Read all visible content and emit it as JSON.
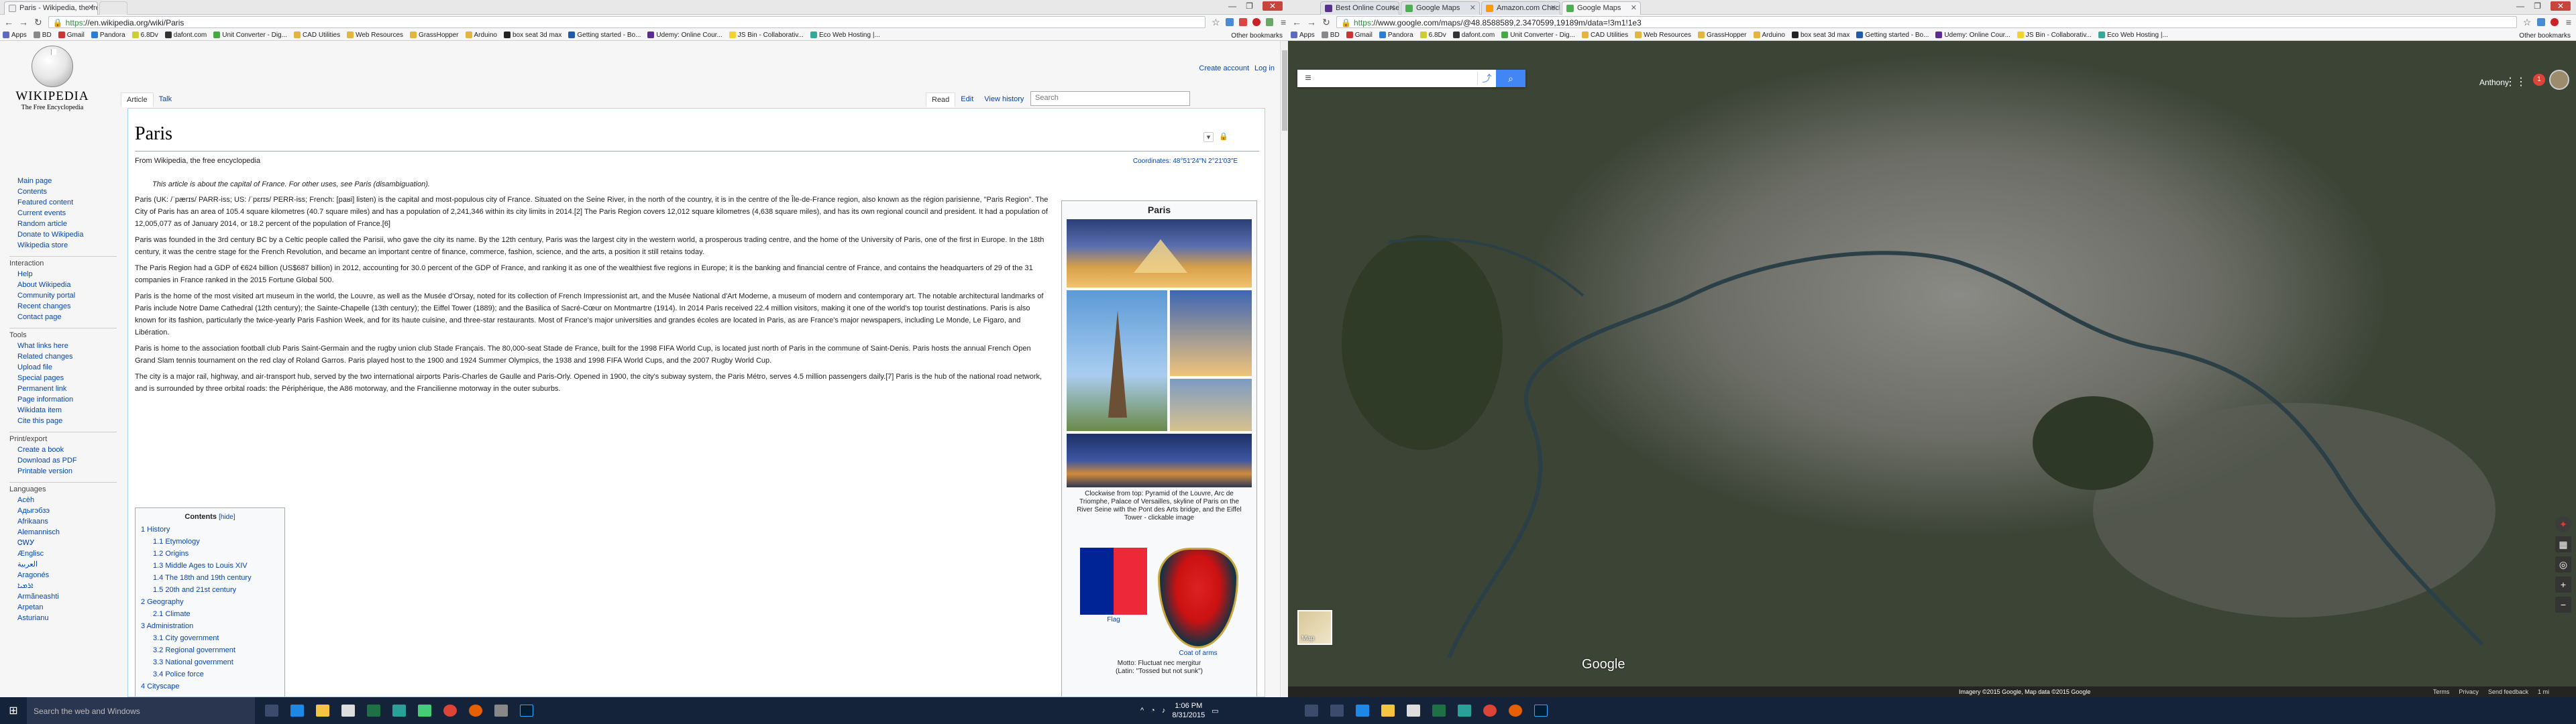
{
  "left_window": {
    "tabs": [
      {
        "title": "Paris - Wikipedia, the free",
        "active": true
      },
      {
        "title": "",
        "active": false
      }
    ],
    "url_https": "https",
    "url_rest": "://en.wikipedia.org/wiki/Paris"
  },
  "right_window": {
    "tabs": [
      {
        "title": "Best Online Courses | Ud...",
        "active": false
      },
      {
        "title": "Google Maps",
        "active": false
      },
      {
        "title": "Amazon.com Checkout",
        "active": false
      },
      {
        "title": "Google Maps",
        "active": true
      }
    ],
    "url_https": "https",
    "url_rest": "://www.google.com/maps/@48.8588589,2.3470599,19189m/data=!3m1!1e3"
  },
  "bookmarks": [
    "Apps",
    "BD",
    "Gmail",
    "Pandora",
    "6.8Dv",
    "dafont.com",
    "Unit Converter - Dig...",
    "CAD Utilities",
    "Web Resources",
    "GrassHopper",
    "Arduino",
    "box seat 3d max",
    "Getting started - Bo...",
    "Udemy: Online Cour...",
    "JS Bin - Collaborativ...",
    "Eco Web Hosting |..."
  ],
  "bookmarks_right": [
    "Apps",
    "BD",
    "Gmail",
    "Pandora",
    "6.8Dv",
    "dafont.com",
    "Unit Converter - Dig...",
    "CAD Utilities",
    "Web Resources",
    "GrassHopper",
    "Arduino",
    "box seat 3d max",
    "Getting started - Bo...",
    "Udemy: Online Cour...",
    "JS Bin - Collaborativ...",
    "Eco Web Hosting |..."
  ],
  "other_bookmarks": "Other bookmarks",
  "wiki": {
    "logo_title": "WIKIPEDIA",
    "logo_sub": "The Free Encyclopedia",
    "create_account": "Create account",
    "log_in": "Log in",
    "tab_article": "Article",
    "tab_talk": "Talk",
    "tab_read": "Read",
    "tab_edit": "Edit",
    "tab_history": "View history",
    "search_placeholder": "Search",
    "nav": [
      "Main page",
      "Contents",
      "Featured content",
      "Current events",
      "Random article",
      "Donate to Wikipedia",
      "Wikipedia store"
    ],
    "interaction_head": "Interaction",
    "interaction": [
      "Help",
      "About Wikipedia",
      "Community portal",
      "Recent changes",
      "Contact page"
    ],
    "tools_head": "Tools",
    "tools": [
      "What links here",
      "Related changes",
      "Upload file",
      "Special pages",
      "Permanent link",
      "Page information",
      "Wikidata item",
      "Cite this page"
    ],
    "print_head": "Print/export",
    "print": [
      "Create a book",
      "Download as PDF",
      "Printable version"
    ],
    "lang_head": "Languages",
    "langs": [
      "Acèh",
      "Адыгэбзэ",
      "Afrikaans",
      "Alemannisch",
      "ᏣᎳᎩ",
      "Ænglisc",
      "العربية",
      "Aragonés",
      "ܐܪܡܝܐ",
      "Armãneashti",
      "Arpetan",
      "Asturianu"
    ],
    "title": "Paris",
    "from": "From Wikipedia, the free encyclopedia",
    "coordinates": "Coordinates: 48°51′24″N 2°21′03″E",
    "hatnote": "This article is about the capital of France. For other uses, see Paris (disambiguation).",
    "paragraphs": [
      "Paris (UK: /ˈpærɪs/ PARR-iss; US: /ˈpɛrɪs/ PERR-iss; French: [paʁi] listen) is the capital and most-populous city of France. Situated on the Seine River, in the north of the country, it is in the centre of the Île-de-France region, also known as the région parisienne, \"Paris Region\". The City of Paris has an area of 105.4 square kilometres (40.7 square miles) and has a population of 2,241,346 within its city limits in 2014.[2] The Paris Region covers 12,012 square kilometres (4,638 square miles), and has its own regional council and president. It had a population of 12,005,077 as of January 2014, or 18.2 percent of the population of France.[6]",
      "Paris was founded in the 3rd century BC by a Celtic people called the Parisii, who gave the city its name. By the 12th century, Paris was the largest city in the western world, a prosperous trading centre, and the home of the University of Paris, one of the first in Europe. In the 18th century, it was the centre stage for the French Revolution, and became an important centre of finance, commerce, fashion, science, and the arts, a position it still retains today.",
      "The Paris Region had a GDP of €624 billion (US$687 billion) in 2012, accounting for 30.0 percent of the GDP of France, and ranking it as one of the wealthiest five regions in Europe; it is the banking and financial centre of France, and contains the headquarters of 29 of the 31 companies in France ranked in the 2015 Fortune Global 500.",
      "Paris is the home of the most visited art museum in the world, the Louvre, as well as the Musée d'Orsay, noted for its collection of French Impressionist art, and the Musée National d'Art Moderne, a museum of modern and contemporary art. The notable architectural landmarks of Paris include Notre Dame Cathedral (12th century); the Sainte-Chapelle (13th century); the Eiffel Tower (1889); and the Basilica of Sacré-Cœur on Montmartre (1914). In 2014 Paris received 22.4 million visitors, making it one of the world's top tourist destinations. Paris is also known for its fashion, particularly the twice-yearly Paris Fashion Week, and for its haute cuisine, and three-star restaurants. Most of France's major universities and grandes écoles are located in Paris, as are France's major newspapers, including Le Monde, Le Figaro, and Libération.",
      "Paris is home to the association football club Paris Saint-Germain and the rugby union club Stade Français. The 80,000-seat Stade de France, built for the 1998 FIFA World Cup, is located just north of Paris in the commune of Saint-Denis. Paris hosts the annual French Open Grand Slam tennis tournament on the red clay of Roland Garros. Paris played host to the 1900 and 1924 Summer Olympics, the 1938 and 1998 FIFA World Cups, and the 2007 Rugby World Cup.",
      "The city is a major rail, highway, and air-transport hub, served by the two international airports Paris-Charles de Gaulle and Paris-Orly. Opened in 1900, the city's subway system, the Paris Métro, serves 4.5 million passengers daily.[7] Paris is the hub of the national road network, and is surrounded by three orbital roads: the Périphérique, the A86 motorway, and the Francilienne motorway in the outer suburbs."
    ],
    "toc_title": "Contents",
    "toc_hide": "[hide]",
    "toc": [
      {
        "t": "1 History",
        "l": 1
      },
      {
        "t": "1.1 Etymology",
        "l": 2
      },
      {
        "t": "1.2 Origins",
        "l": 2
      },
      {
        "t": "1.3 Middle Ages to Louis XIV",
        "l": 2
      },
      {
        "t": "1.4 The 18th and 19th century",
        "l": 2
      },
      {
        "t": "1.5 20th and 21st century",
        "l": 2
      },
      {
        "t": "2 Geography",
        "l": 1
      },
      {
        "t": "2.1 Climate",
        "l": 2
      },
      {
        "t": "3 Administration",
        "l": 1
      },
      {
        "t": "3.1 City government",
        "l": 2
      },
      {
        "t": "3.2 Regional government",
        "l": 2
      },
      {
        "t": "3.3 National government",
        "l": 2
      },
      {
        "t": "3.4 Police force",
        "l": 2
      },
      {
        "t": "4 Cityscape",
        "l": 1
      }
    ],
    "infobox_title": "Paris",
    "infobox_caption": "Clockwise from top: Pyramid of the Louvre, Arc de Triomphe, Palace of Versailles, skyline of Paris on the River Seine with the Pont des Arts bridge, and the Eiffel Tower - clickable image",
    "flag_label": "Flag",
    "coa_label": "Coat of arms",
    "motto": "Motto: Fluctuat nec mergitur",
    "motto_latin": "(Latin: \"Tossed but not sunk\")"
  },
  "maps": {
    "user": "Anthony",
    "notif_count": "1",
    "map_thumb_label": "Map",
    "google": "Google",
    "footer": [
      "Imagery ©2015 Google, Map data ©2015 Google",
      "Terms",
      "Privacy",
      "Send feedback",
      "1 mi"
    ]
  },
  "taskbar": {
    "search_placeholder": "Search the web and Windows",
    "time": "1:06 PM",
    "date": "8/31/2015"
  },
  "colors": {
    "wiki_link": "#0645ad",
    "maps_blue": "#4285f4",
    "taskbar": "#14223a",
    "flag_blue": "#002395",
    "flag_red": "#ed2939"
  }
}
